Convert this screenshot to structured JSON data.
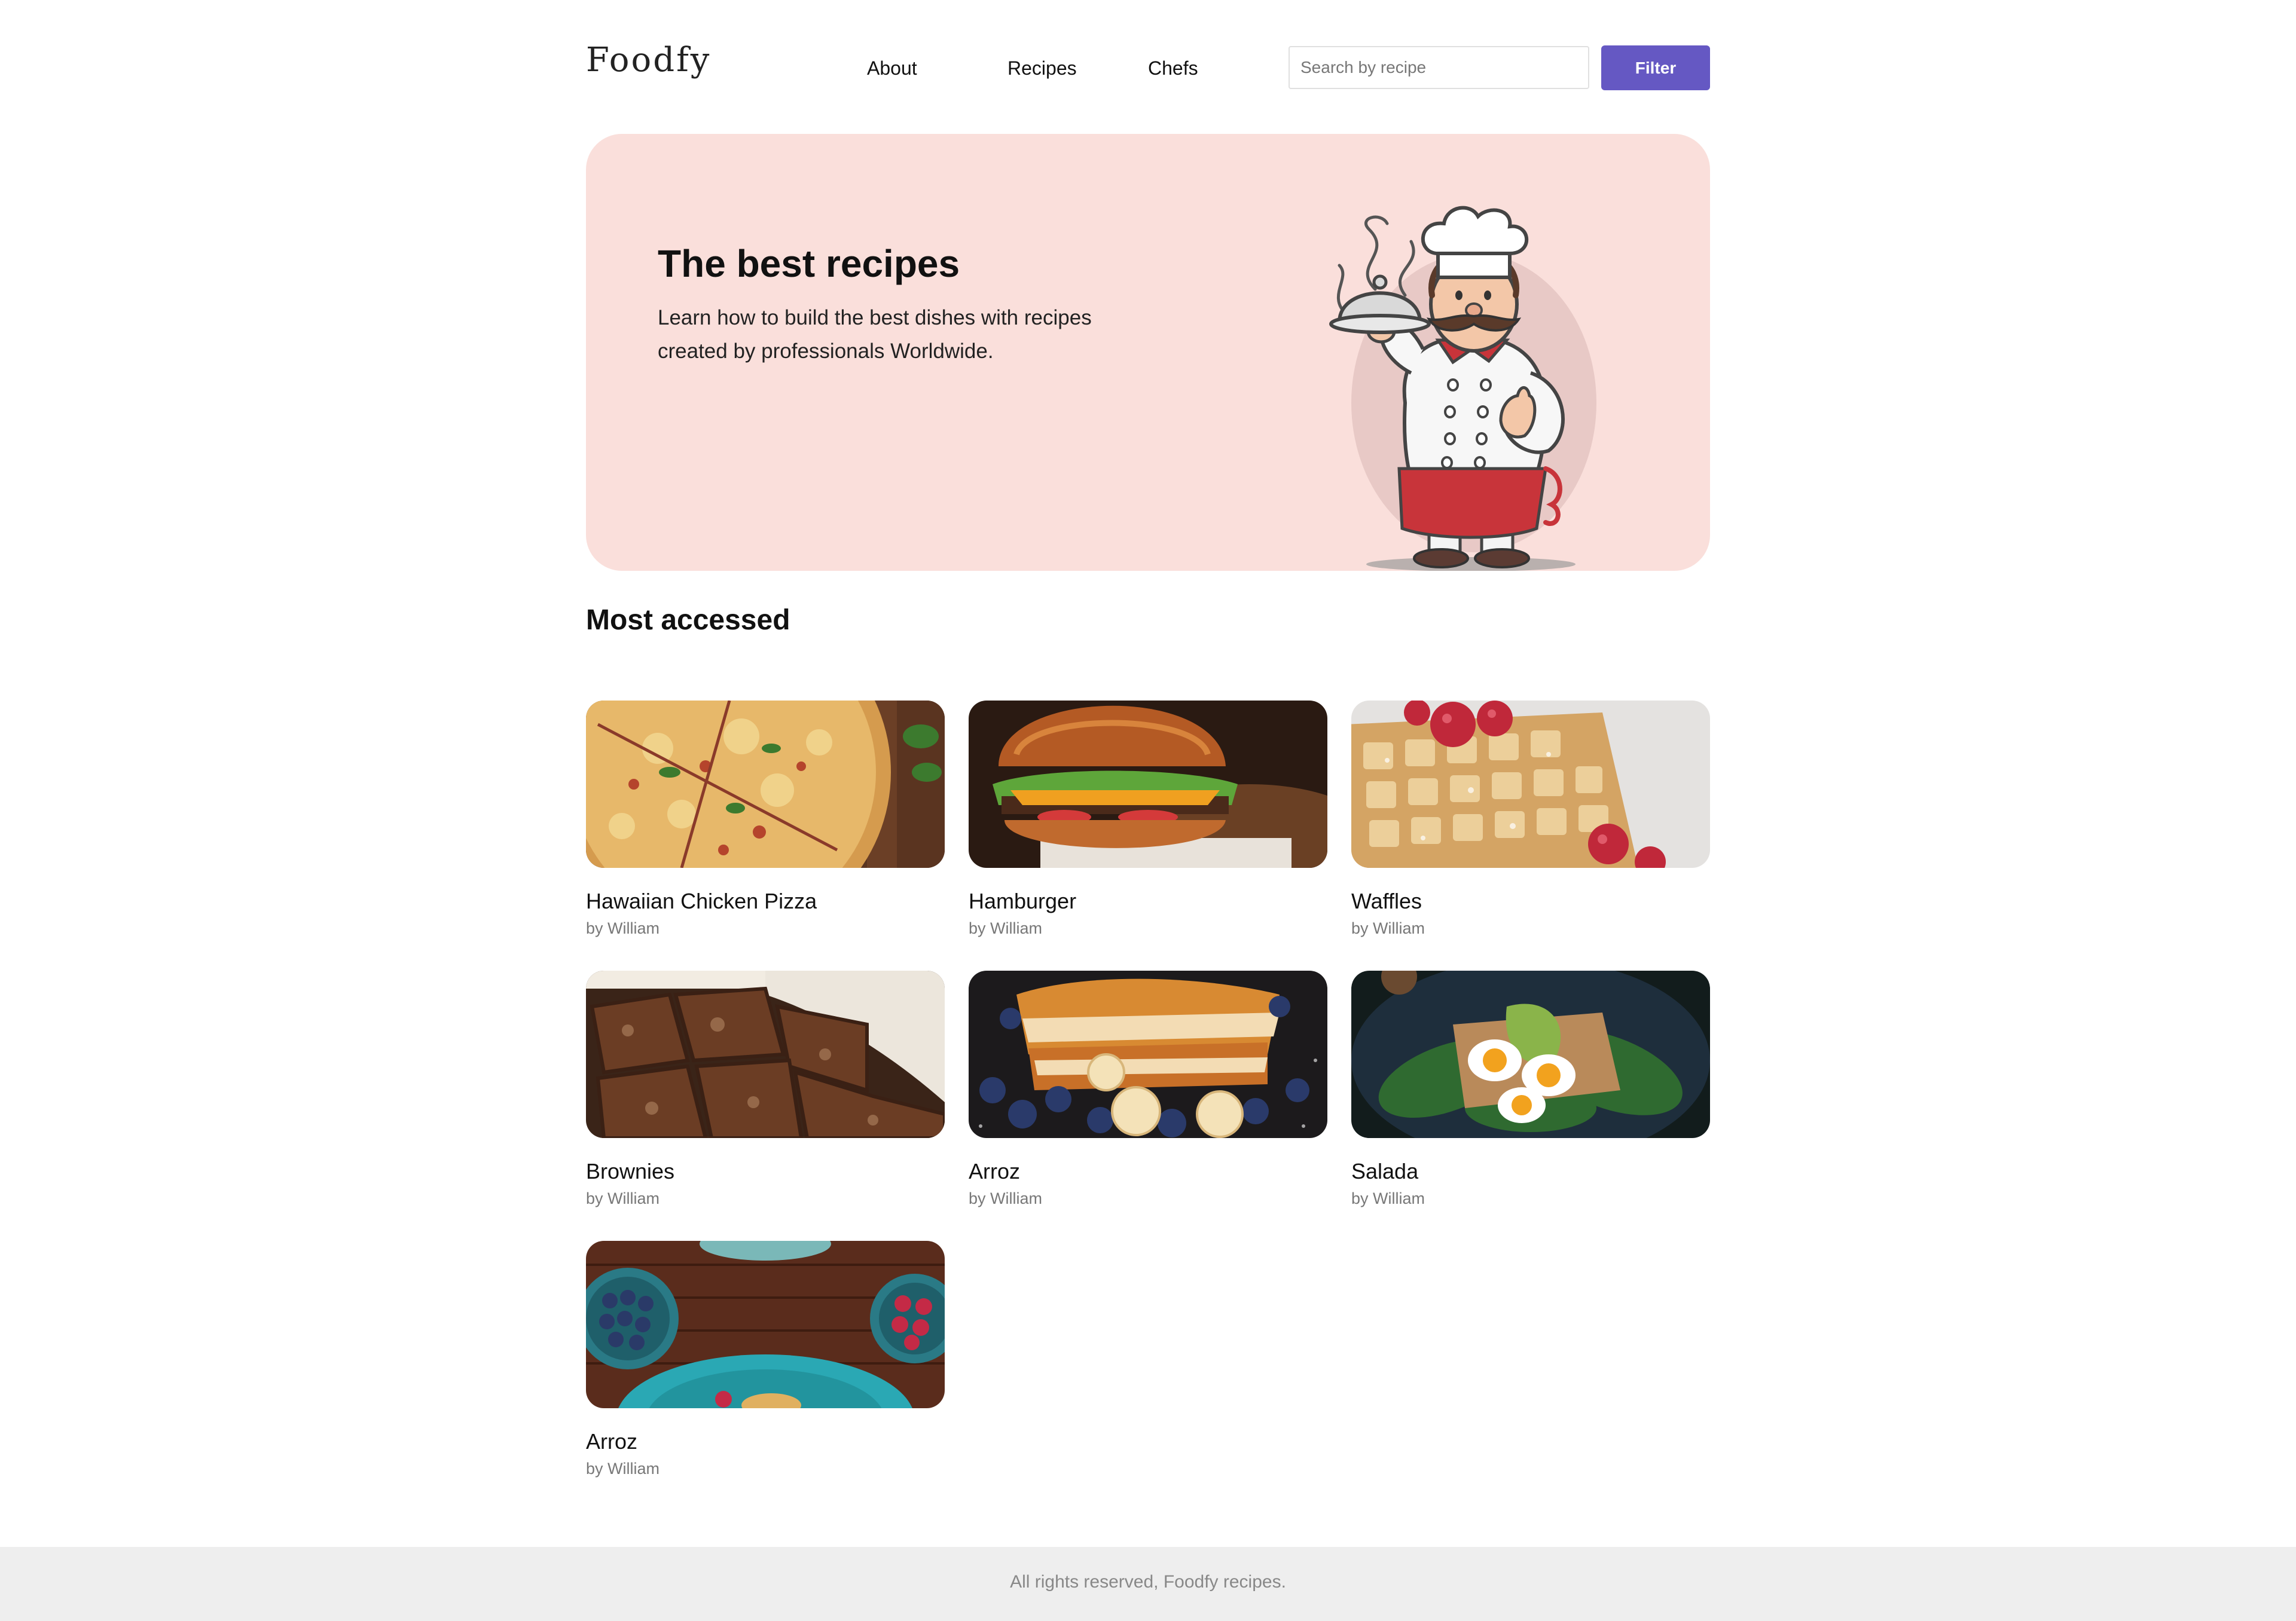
{
  "header": {
    "logo": "Foodfy",
    "nav": [
      {
        "label": "About"
      },
      {
        "label": "Recipes"
      },
      {
        "label": "Chefs"
      }
    ],
    "search": {
      "placeholder": "Search by recipe",
      "value": ""
    },
    "filter_label": "Filter"
  },
  "hero": {
    "title": "The best recipes",
    "text": "Learn how to build the best dishes with recipes created by professionals Worldwide.",
    "illustration": "chef-illustration"
  },
  "section": {
    "title": "Most accessed"
  },
  "recipes": [
    {
      "title": "Hawaiian Chicken Pizza",
      "author": "by William",
      "image": "pizza-photo"
    },
    {
      "title": "Hamburger",
      "author": "by William",
      "image": "hamburger-photo"
    },
    {
      "title": "Waffles",
      "author": "by William",
      "image": "waffles-photo"
    },
    {
      "title": "Brownies",
      "author": "by William",
      "image": "brownies-photo"
    },
    {
      "title": "Arroz",
      "author": "by William",
      "image": "french-toast-photo"
    },
    {
      "title": "Salada",
      "author": "by William",
      "image": "salad-photo"
    },
    {
      "title": "Arroz",
      "author": "by William",
      "image": "table-dishes-photo"
    }
  ],
  "footer": {
    "text": "All rights reserved, Foodfy recipes."
  },
  "colors": {
    "accent": "#6558c3",
    "hero_background": "#fadfdb",
    "footer_background": "#eeeeee",
    "muted_text": "#777777"
  }
}
